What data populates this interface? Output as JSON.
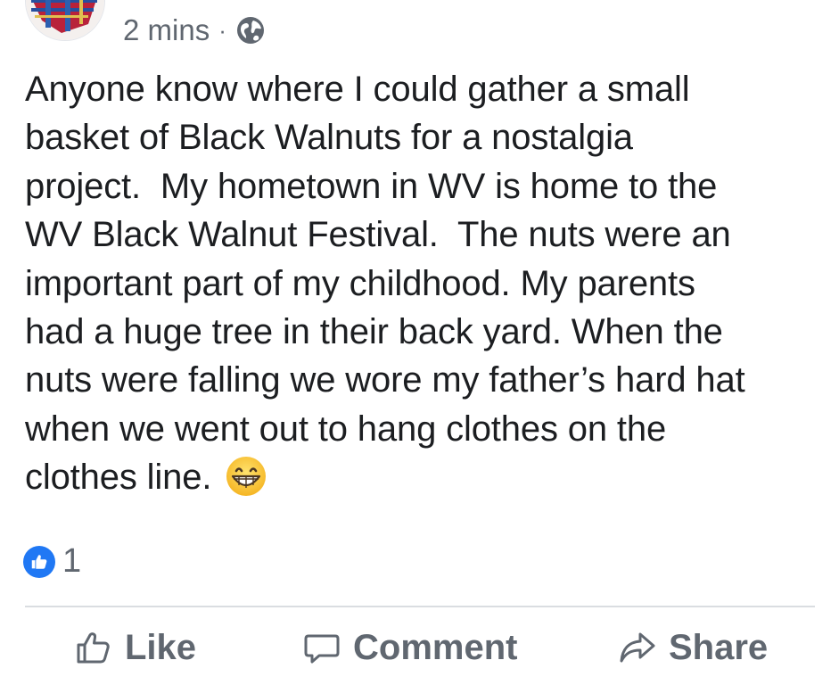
{
  "post": {
    "timestamp": "2 mins",
    "separator": "·",
    "privacy_icon": "globe-icon",
    "text_lines": [
      "Anyone know where I could gather a small",
      "basket of Black Walnuts for a nostalgia",
      "project.  My hometown in WV is home to the",
      "WV Black Walnut Festival.  The nuts were an",
      "important part of my childhood. My parents",
      "had a huge tree in their back yard. When the",
      "nuts were falling we wore my father’s hard hat",
      "when we went out to hang clothes on the",
      "clothes line."
    ],
    "emoji_icon": "grinning-face-emoji"
  },
  "reactions": {
    "icon": "thumbs-up-icon",
    "count": "1"
  },
  "actions": {
    "like_label": "Like",
    "comment_label": "Comment",
    "share_label": "Share"
  },
  "colors": {
    "text": "#1c1e21",
    "meta": "#606770",
    "accent": "#2078f4",
    "divider": "#dadde1"
  }
}
